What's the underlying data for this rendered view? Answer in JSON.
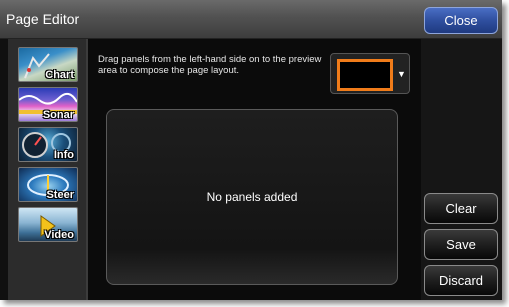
{
  "window": {
    "title": "Page Editor",
    "close_label": "Close"
  },
  "sidebar": {
    "items": [
      {
        "label": "Chart",
        "icon": "chart-icon"
      },
      {
        "label": "Sonar",
        "icon": "sonar-icon"
      },
      {
        "label": "Info",
        "icon": "info-icon"
      },
      {
        "label": "Steer",
        "icon": "steer-icon"
      },
      {
        "label": "Video",
        "icon": "video-icon"
      }
    ]
  },
  "main": {
    "instructions": "Drag panels from the left-hand side on to the preview area to compose the page layout.",
    "preview_message": "No panels added"
  },
  "actions": {
    "clear_label": "Clear",
    "save_label": "Save",
    "discard_label": "Discard"
  },
  "colors": {
    "accent_close": "#2f4f9f",
    "layout_highlight": "#f07c1a"
  }
}
